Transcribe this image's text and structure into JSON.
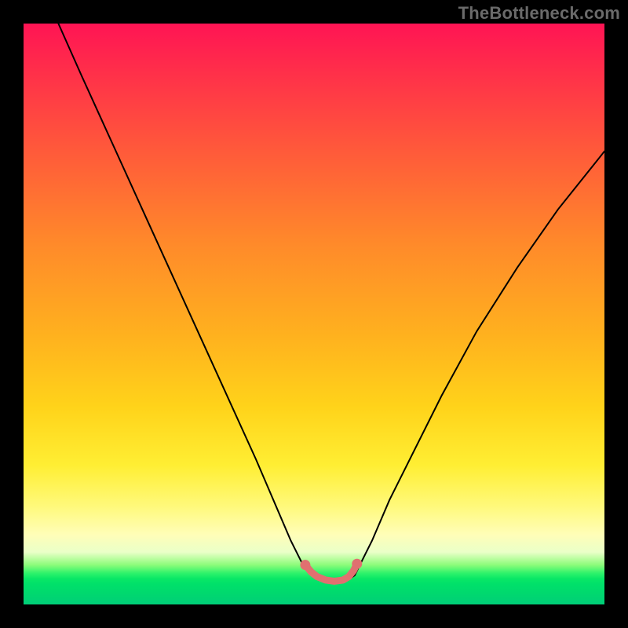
{
  "watermark": "TheBottleneck.com",
  "chart_data": {
    "type": "line",
    "title": "",
    "xlabel": "",
    "ylabel": "",
    "xlim": [
      0,
      100
    ],
    "ylim": [
      0,
      100
    ],
    "grid": false,
    "legend": false,
    "series": [
      {
        "name": "bottleneck-curve",
        "color": "#000000",
        "x": [
          6,
          10,
          15,
          20,
          25,
          30,
          35,
          40,
          43,
          46,
          48,
          50,
          52,
          54,
          56,
          57,
          58,
          60,
          63,
          67,
          72,
          78,
          85,
          92,
          100
        ],
        "values": [
          100,
          91,
          80,
          69,
          58,
          47,
          36,
          25,
          18,
          11,
          7,
          5,
          4.2,
          4.0,
          4.3,
          5,
          7,
          11,
          18,
          26,
          36,
          47,
          58,
          68,
          78
        ]
      },
      {
        "name": "sweet-zone-marker",
        "color": "#e07070",
        "x": [
          48.5,
          49.5,
          50.5,
          52.0,
          53.5,
          55.0,
          56.0,
          56.8,
          57.4
        ],
        "values": [
          6.8,
          5.6,
          4.8,
          4.2,
          4.0,
          4.2,
          4.8,
          5.8,
          7.0
        ]
      }
    ],
    "annotations": []
  }
}
